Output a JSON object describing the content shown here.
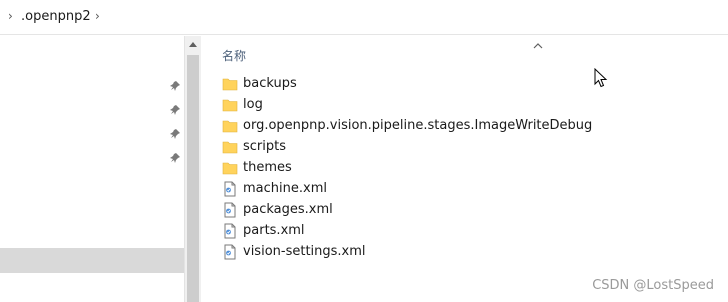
{
  "address_bar": {
    "crumb": ".openpnp2",
    "chevron_icon": "chevron-right-icon"
  },
  "nav_pane": {
    "pin_icon": "pin-icon",
    "pinned_count": 4
  },
  "content": {
    "column_header": "名称",
    "sort_icon": "sort-up-icon",
    "items": [
      {
        "name": "backups",
        "type": "folder"
      },
      {
        "name": "log",
        "type": "folder"
      },
      {
        "name": "org.openpnp.vision.pipeline.stages.ImageWriteDebug",
        "type": "folder"
      },
      {
        "name": "scripts",
        "type": "folder"
      },
      {
        "name": "themes",
        "type": "folder"
      },
      {
        "name": "machine.xml",
        "type": "xml-file"
      },
      {
        "name": "packages.xml",
        "type": "xml-file"
      },
      {
        "name": "parts.xml",
        "type": "xml-file"
      },
      {
        "name": "vision-settings.xml",
        "type": "xml-file"
      }
    ]
  },
  "colors": {
    "folder": "#ffd35c",
    "selection": "#d9d9d9",
    "scrollbar_track": "#f0f0f0",
    "scrollbar_thumb": "#cdcdcd"
  },
  "watermark": "CSDN @LostSpeed"
}
